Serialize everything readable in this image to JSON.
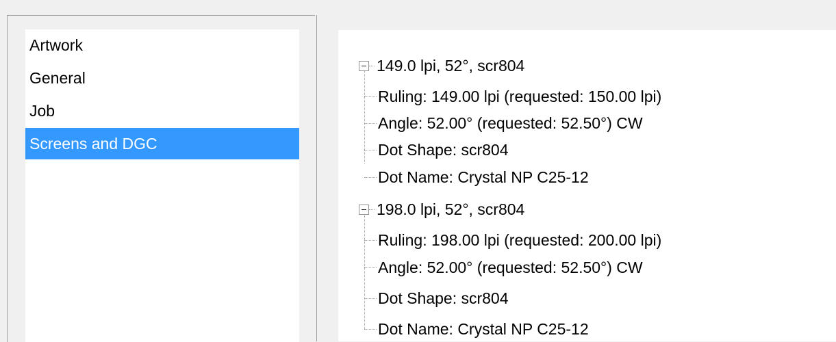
{
  "left_list": {
    "items": [
      {
        "label": "Artwork",
        "selected": false
      },
      {
        "label": "General",
        "selected": false
      },
      {
        "label": "Job",
        "selected": false
      },
      {
        "label": "Screens and DGC",
        "selected": true
      }
    ]
  },
  "tree": {
    "nodes": [
      {
        "label": "149.0 lpi, 52°, scr804",
        "expanded": true,
        "children": [
          {
            "label": "Ruling: 149.00 lpi (requested: 150.00 lpi)"
          },
          {
            "label": "Angle: 52.00° (requested: 52.50°) CW"
          },
          {
            "label": "Dot Shape: scr804"
          },
          {
            "label": "Dot Name: Crystal NP C25-12"
          }
        ]
      },
      {
        "label": "198.0 lpi, 52°, scr804",
        "expanded": true,
        "children": [
          {
            "label": "Ruling: 198.00 lpi (requested: 200.00 lpi)"
          },
          {
            "label": "Angle: 52.00° (requested: 52.50°) CW"
          },
          {
            "label": "Dot Shape: scr804"
          },
          {
            "label": "Dot Name: Crystal NP C25-12"
          }
        ]
      }
    ]
  },
  "colors": {
    "selection": "#3399ff",
    "window_bg": "#f0f0f0",
    "panel_bg": "#ffffff"
  }
}
